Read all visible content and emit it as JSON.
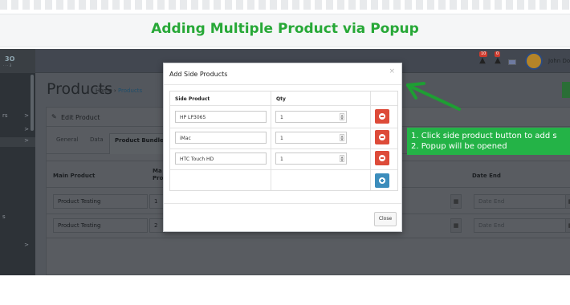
{
  "banner": {
    "title": "Adding Multiple Product via Popup"
  },
  "sidebar": {
    "logo": "3O",
    "logo_sub": "· · · 3",
    "items": [
      {
        "label": "rs",
        "chevron": ">"
      },
      {
        "label": "",
        "chevron": ">"
      },
      {
        "label": "",
        "chevron": ">"
      },
      {
        "label": "",
        "chevron": ">"
      },
      {
        "label": "s",
        "chevron": ""
      },
      {
        "label": "",
        "chevron": ">"
      }
    ]
  },
  "topbar": {
    "badge1": "10",
    "badge2": "0",
    "user_name": "John Doe"
  },
  "page": {
    "title": "Products",
    "breadcrumb_home": "Home",
    "breadcrumb_sep": "›",
    "breadcrumb_current": "Products"
  },
  "panel": {
    "heading": "Edit Product",
    "tabs": [
      "General",
      "Data",
      "Product Bundle"
    ],
    "columns": [
      "Main Product",
      "Ma Pro",
      "Date End"
    ],
    "rows": [
      {
        "product": "Product Testing",
        "qty": "1",
        "date_end": "Date End"
      },
      {
        "product": "Product Testing",
        "qty": "2",
        "date_end": "Date End"
      }
    ]
  },
  "modal": {
    "title": "Add Side Products",
    "close_icon": "×",
    "col_product": "Side Product",
    "col_qty": "Qty",
    "rows": [
      {
        "product": "HP LP3065",
        "qty": "1"
      },
      {
        "product": "iMac",
        "qty": "1"
      },
      {
        "product": "HTC Touch HD",
        "qty": "1"
      }
    ],
    "close_label": "Close"
  },
  "note": {
    "line1": "1. Click side product button to add s",
    "line2": "2. Popup will be opened"
  },
  "colors": {
    "banner_text": "#27a837",
    "note_bg": "#24b347",
    "delete": "#dd4b39",
    "add": "#3c8dbc"
  },
  "icons": [
    "pencil-icon",
    "calendar-icon",
    "minus-circle-icon",
    "plus-circle-icon",
    "bell-icon",
    "flag-icon",
    "arrow-icon"
  ]
}
